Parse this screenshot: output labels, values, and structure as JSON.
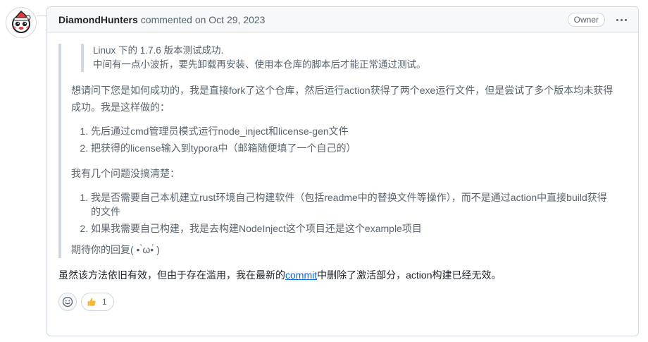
{
  "comment": {
    "author": "DiamondHunters",
    "meta": "commented on Oct 29, 2023",
    "badge": "Owner",
    "icons": {
      "avatar": "avatar-icon",
      "more": "kebab-horizontal-icon",
      "add_reaction": "smiley-icon",
      "thumbs_up": "thumbs-up-icon"
    },
    "quote": {
      "nested_lines": [
        "Linux 下的 1.7.6 版本测试成功.",
        "中间有一点小波折，要先卸载再安装、使用本仓库的脚本后才能正常通过测试。"
      ],
      "para1_line1": "想请问下您是如何成功的，我是直接fork了这个仓库，然后运行action获得了两个exe运行文件，但是尝试了多个版本均未获得",
      "para1_line2": "成功。我是这样做的：",
      "list1": [
        "先后通过cmd管理员模式运行node_inject和license-gen文件",
        "把获得的license输入到typora中（邮箱随便填了一个自己的）"
      ],
      "para2": "我有几个问题没搞清楚：",
      "list2_item1_line1": "我是否需要自己本机建立rust环境自己构建软件（包括readme中的替换文件等操作），而不是通过action中直接build获得",
      "list2_item1_line2": "的文件",
      "list2_item2": "如果我需要自己构建，我是去构建NodeInject这个项目还是这个example项目",
      "para3": "期待你的回复( • ̀ω•́ )"
    },
    "reply": {
      "before": "虽然该方法依旧有效，但由于存在滥用，我在最新的",
      "link": "commit",
      "after": "中删除了激活部分，action构建已经无效。"
    },
    "reactions": {
      "thumbs_up_count": "1"
    }
  },
  "colors": {
    "border": "#d0d7de",
    "header_bg": "#f6f8fa",
    "muted_text": "#59636e",
    "link": "#0969da"
  }
}
